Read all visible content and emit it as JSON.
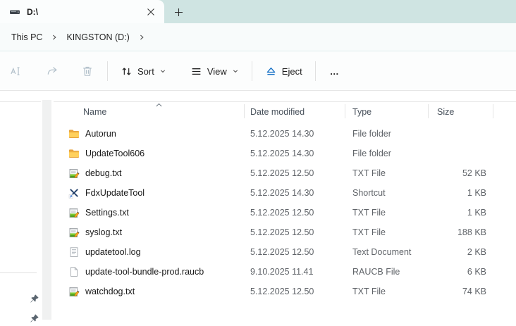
{
  "colors": {
    "tabbar_bg": "#cfe4e2",
    "active_tab_bg": "#fbfdfd",
    "eject_blue": "#1771c6",
    "disabled_icon": "#b3c1cb",
    "secondary_text": "#5f6368"
  },
  "tabbar": {
    "tab_title": "D:\\",
    "tab_icon": "drive-icon",
    "close_icon": "close-icon",
    "new_tab_icon": "plus-icon"
  },
  "breadcrumb": {
    "items": [
      "This PC",
      "KINGSTON (D:)"
    ]
  },
  "toolbar": {
    "rename_icon": "rename-icon",
    "share_icon": "share-icon",
    "delete_icon": "trash-icon",
    "sort": "Sort",
    "view": "View",
    "eject": "Eject",
    "more": "…"
  },
  "list": {
    "columns": [
      "Name",
      "Date modified",
      "Type",
      "Size"
    ],
    "sort": {
      "column": "Name",
      "direction": "ascending"
    },
    "rows": [
      {
        "icon": "folder",
        "name": "Autorun",
        "date": "5.12.2025 14.30",
        "type": "File folder",
        "size": ""
      },
      {
        "icon": "folder",
        "name": "UpdateTool606",
        "date": "5.12.2025 14.30",
        "type": "File folder",
        "size": ""
      },
      {
        "icon": "txt",
        "name": "debug.txt",
        "date": "5.12.2025 12.50",
        "type": "TXT File",
        "size": "52 KB"
      },
      {
        "icon": "shortcut",
        "name": "FdxUpdateTool",
        "date": "5.12.2025 14.30",
        "type": "Shortcut",
        "size": "1 KB"
      },
      {
        "icon": "txt",
        "name": "Settings.txt",
        "date": "5.12.2025 12.50",
        "type": "TXT File",
        "size": "1 KB"
      },
      {
        "icon": "txt",
        "name": "syslog.txt",
        "date": "5.12.2025 12.50",
        "type": "TXT File",
        "size": "188 KB"
      },
      {
        "icon": "log",
        "name": "updatetool.log",
        "date": "5.12.2025 12.50",
        "type": "Text Document",
        "size": "2 KB"
      },
      {
        "icon": "raucb",
        "name": "update-tool-bundle-prod.raucb",
        "date": "9.10.2025 11.41",
        "type": "RAUCB File",
        "size": "6 KB"
      },
      {
        "icon": "txt",
        "name": "watchdog.txt",
        "date": "5.12.2025 12.50",
        "type": "TXT File",
        "size": "74 KB"
      }
    ]
  }
}
